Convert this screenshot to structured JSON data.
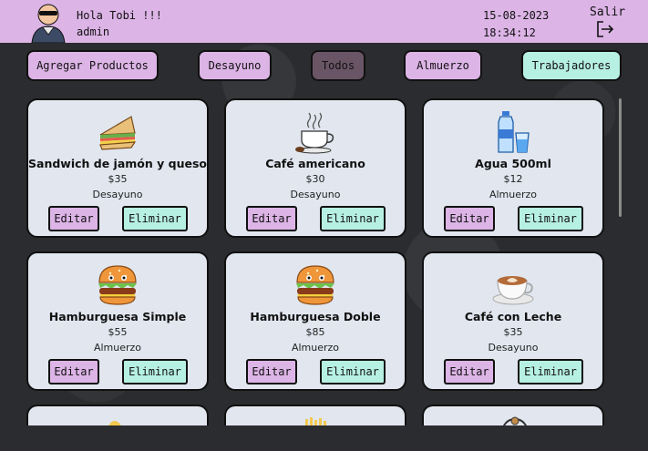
{
  "header": {
    "greeting": "Hola Tobi !!!",
    "username": "admin",
    "date": "15-08-2023",
    "time": "18:34:12",
    "logout_label": "Salir"
  },
  "filters": {
    "add_products": "Agregar Productos",
    "breakfast": "Desayuno",
    "all": "Todos",
    "lunch": "Almuerzo",
    "workers": "Trabajadores",
    "active": "Todos"
  },
  "actions": {
    "edit": "Editar",
    "delete": "Eliminar"
  },
  "products": [
    {
      "name": "Sandwich de jamón y queso",
      "price": "$35",
      "category": "Desayuno",
      "icon": "sandwich-icon"
    },
    {
      "name": "Café americano",
      "price": "$30",
      "category": "Desayuno",
      "icon": "coffee-cup-icon"
    },
    {
      "name": "Agua 500ml",
      "price": "$12",
      "category": "Almuerzo",
      "icon": "water-bottle-icon"
    },
    {
      "name": "Hamburguesa Simple",
      "price": "$55",
      "category": "Almuerzo",
      "icon": "burger-icon"
    },
    {
      "name": "Hamburguesa Doble",
      "price": "$85",
      "category": "Almuerzo",
      "icon": "burger-icon"
    },
    {
      "name": "Café con Leche",
      "price": "$35",
      "category": "Desayuno",
      "icon": "latte-icon"
    }
  ],
  "colors": {
    "header_bg": "#dcb4e6",
    "edit_bg": "#dcb4e6",
    "delete_bg": "#b6f0e2",
    "active_filter_bg": "#6a5567",
    "card_bg": "#e1e6ef",
    "page_bg": "#2b2c2f"
  }
}
